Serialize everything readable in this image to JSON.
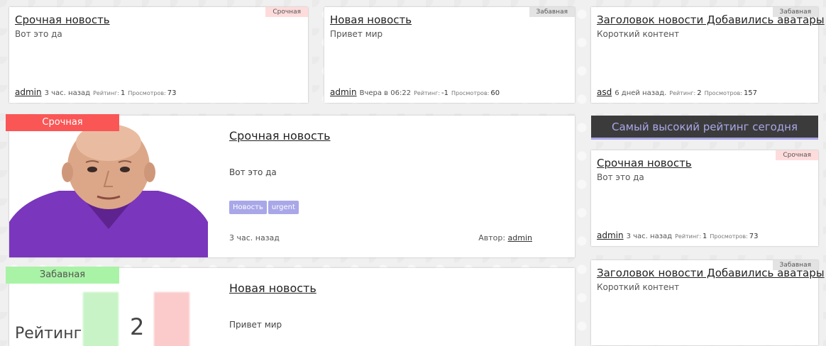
{
  "top_cards": [
    {
      "tag": "Срочная",
      "title": "Срочная новость",
      "content": "Вот это да",
      "author": "admin",
      "time": "3 час. назад",
      "rating_label": "Рейтинг:",
      "rating": "1",
      "views_label": "Просмотров:",
      "views": "73"
    },
    {
      "tag": "Забавная",
      "title": "Новая новость",
      "content": "Привет мир",
      "author": "admin",
      "time": "Вчера в 06:22",
      "rating_label": "Рейтинг:",
      "rating": "-1",
      "views_label": "Просмотров:",
      "views": "60"
    },
    {
      "tag": "Забавная",
      "title": "Заголовок новости Добавились аватары",
      "content": "Короткий контент",
      "author": "asd",
      "time": "6 дней назад.",
      "rating_label": "Рейтинг:",
      "rating": "2",
      "views_label": "Просмотров:",
      "views": "157"
    }
  ],
  "feed": [
    {
      "badge": "Срочная",
      "badge_color": "#fa5656",
      "title": "Срочная новость",
      "content": "Вот это да",
      "tags": [
        "Новость",
        "urgent"
      ],
      "time": "3 час. назад",
      "author_label": "Автор:",
      "author": "admin"
    },
    {
      "badge": "Забавная",
      "badge_color": "#a9f3a6",
      "title": "Новая новость",
      "content": "Привет мир",
      "image_text": "Рейтинг",
      "image_number": "2"
    }
  ],
  "sidebar": {
    "heading": "Самый высокий рейтинг сегодня",
    "cards": [
      {
        "tag": "Срочная",
        "title": "Срочная новость",
        "content": "Вот это да",
        "author": "admin",
        "time": "3 час. назад",
        "rating_label": "Рейтинг:",
        "rating": "1",
        "views_label": "Просмотров:",
        "views": "73"
      },
      {
        "tag": "Забавная",
        "title": "Заголовок новости Добавились аватары",
        "content": "Короткий контент"
      }
    ]
  },
  "colors": {
    "tag_urgent": "#ffdcdc",
    "tag_funny": "#e3e3e3",
    "chip": "#a9a7e8",
    "sidebar_heading_bg": "#3b3b3b",
    "sidebar_heading_text": "#a9a7e8"
  }
}
